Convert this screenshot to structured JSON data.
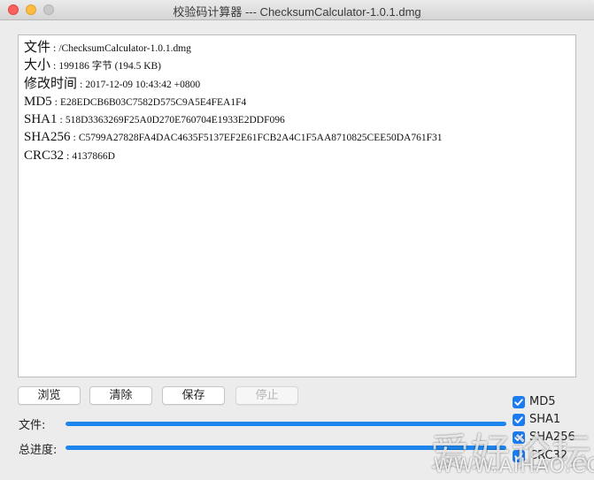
{
  "window": {
    "title": "校验码计算器 --- ChecksumCalculator-1.0.1.dmg"
  },
  "output": {
    "lines": [
      {
        "key": "文件",
        "sep": " : ",
        "value": "/ChecksumCalculator-1.0.1.dmg"
      },
      {
        "key": "大小",
        "sep": " : ",
        "value": "199186 字节 (194.5 KB)"
      },
      {
        "key": "修改时间",
        "sep": " : ",
        "value": "2017-12-09 10:43:42 +0800"
      },
      {
        "key": "MD5",
        "sep": " : ",
        "value": "E28EDCB6B03C7582D575C9A5E4FEA1F4"
      },
      {
        "key": "SHA1",
        "sep": " : ",
        "value": "518D3363269F25A0D270E760704E1933E2DDF096"
      },
      {
        "key": "SHA256",
        "sep": " : ",
        "value": "C5799A27828FA4DAC4635F5137EF2E61FCB2A4C1F5AA8710825CEE50DA761F31"
      },
      {
        "key": "CRC32",
        "sep": " : ",
        "value": "4137866D"
      }
    ]
  },
  "buttons": {
    "browse": "浏览",
    "clear": "清除",
    "save": "保存",
    "stop": "停止"
  },
  "progress": {
    "file_label": "文件:",
    "file_value": 1.0,
    "total_label": "总进度:",
    "total_value": 1.0,
    "color": "#1c86ee"
  },
  "options": [
    {
      "label": "MD5",
      "checked": true
    },
    {
      "label": "SHA1",
      "checked": true
    },
    {
      "label": "SHA256",
      "checked": true
    },
    {
      "label": "CRC32",
      "checked": true
    }
  ],
  "watermark": {
    "main": "爱好论坛",
    "sub": "WWW.AIHAO.CC"
  }
}
